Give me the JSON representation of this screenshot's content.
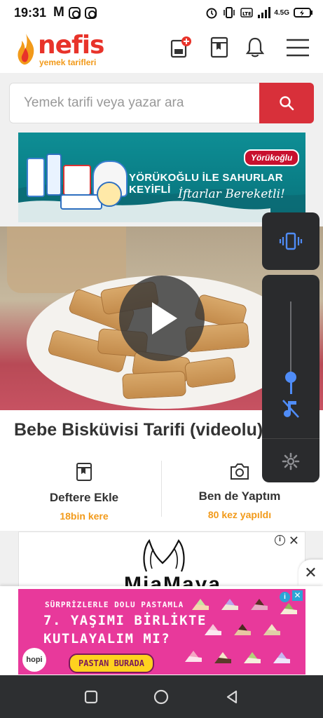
{
  "status_bar": {
    "time": "19:31",
    "network": "4.5G",
    "icons": [
      "m-icon",
      "instagram-icon",
      "instagram-icon",
      "alarm-icon",
      "vibrate-icon",
      "volte-icon",
      "signal-icon",
      "battery-charging-icon"
    ]
  },
  "header": {
    "logo_word": "nefis",
    "logo_tagline": "yemek tarifleri",
    "icons": [
      "add-recipe-icon",
      "notebook-icon",
      "bell-icon",
      "menu-icon"
    ]
  },
  "search": {
    "placeholder": "Yemek tarifi veya yazar ara",
    "button_icon": "search-icon",
    "accent": "#d8303a"
  },
  "banner_ad": {
    "brand": "Yörükoğlu",
    "slogan": "YÖRÜKOĞLU İLE SAHURLAR KEYİFLİ",
    "subline": "İftarlar Bereketli!"
  },
  "recipe": {
    "title": "Bebe Bisküvisi Tarifi (videolu)",
    "actions": [
      {
        "label": "Deftere Ekle",
        "count": "18bin kere",
        "icon": "notebook-icon"
      },
      {
        "label": "Ben de Yaptım",
        "count": "80 kez yapıldı",
        "icon": "camera-icon"
      }
    ],
    "count_color": "#f29a1a"
  },
  "second_ad": {
    "text": "MiaMaya"
  },
  "volume_panel": {
    "mode_icon": "vibrate-icon",
    "media_icon": "music-muted-icon",
    "settings_icon": "gear-icon",
    "accent": "#4f8cf7"
  },
  "bottom_ad": {
    "line1": "SÜRPRİZLERLE DOLU PASTAMLA",
    "line2": "7. YAŞIMI BİRLİKTE",
    "line3": "KUTLAYALIM MI?",
    "cta": "PASTAN BURADA",
    "brand": "hopi",
    "info": "i",
    "close": "✕"
  },
  "bottom_close": "✕",
  "nav_bar": {
    "icons": [
      "recents-icon",
      "home-icon",
      "back-icon"
    ]
  }
}
